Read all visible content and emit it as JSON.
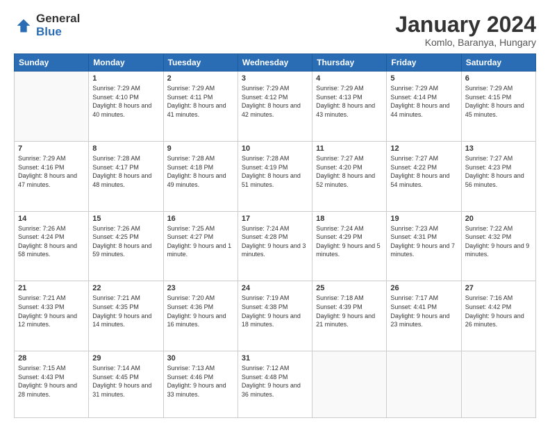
{
  "logo": {
    "general": "General",
    "blue": "Blue"
  },
  "header": {
    "month_year": "January 2024",
    "location": "Komlo, Baranya, Hungary"
  },
  "days_of_week": [
    "Sunday",
    "Monday",
    "Tuesday",
    "Wednesday",
    "Thursday",
    "Friday",
    "Saturday"
  ],
  "weeks": [
    [
      {
        "day": "",
        "sunrise": "",
        "sunset": "",
        "daylight": ""
      },
      {
        "day": "1",
        "sunrise": "Sunrise: 7:29 AM",
        "sunset": "Sunset: 4:10 PM",
        "daylight": "Daylight: 8 hours and 40 minutes."
      },
      {
        "day": "2",
        "sunrise": "Sunrise: 7:29 AM",
        "sunset": "Sunset: 4:11 PM",
        "daylight": "Daylight: 8 hours and 41 minutes."
      },
      {
        "day": "3",
        "sunrise": "Sunrise: 7:29 AM",
        "sunset": "Sunset: 4:12 PM",
        "daylight": "Daylight: 8 hours and 42 minutes."
      },
      {
        "day": "4",
        "sunrise": "Sunrise: 7:29 AM",
        "sunset": "Sunset: 4:13 PM",
        "daylight": "Daylight: 8 hours and 43 minutes."
      },
      {
        "day": "5",
        "sunrise": "Sunrise: 7:29 AM",
        "sunset": "Sunset: 4:14 PM",
        "daylight": "Daylight: 8 hours and 44 minutes."
      },
      {
        "day": "6",
        "sunrise": "Sunrise: 7:29 AM",
        "sunset": "Sunset: 4:15 PM",
        "daylight": "Daylight: 8 hours and 45 minutes."
      }
    ],
    [
      {
        "day": "7",
        "sunrise": "Sunrise: 7:29 AM",
        "sunset": "Sunset: 4:16 PM",
        "daylight": "Daylight: 8 hours and 47 minutes."
      },
      {
        "day": "8",
        "sunrise": "Sunrise: 7:28 AM",
        "sunset": "Sunset: 4:17 PM",
        "daylight": "Daylight: 8 hours and 48 minutes."
      },
      {
        "day": "9",
        "sunrise": "Sunrise: 7:28 AM",
        "sunset": "Sunset: 4:18 PM",
        "daylight": "Daylight: 8 hours and 49 minutes."
      },
      {
        "day": "10",
        "sunrise": "Sunrise: 7:28 AM",
        "sunset": "Sunset: 4:19 PM",
        "daylight": "Daylight: 8 hours and 51 minutes."
      },
      {
        "day": "11",
        "sunrise": "Sunrise: 7:27 AM",
        "sunset": "Sunset: 4:20 PM",
        "daylight": "Daylight: 8 hours and 52 minutes."
      },
      {
        "day": "12",
        "sunrise": "Sunrise: 7:27 AM",
        "sunset": "Sunset: 4:22 PM",
        "daylight": "Daylight: 8 hours and 54 minutes."
      },
      {
        "day": "13",
        "sunrise": "Sunrise: 7:27 AM",
        "sunset": "Sunset: 4:23 PM",
        "daylight": "Daylight: 8 hours and 56 minutes."
      }
    ],
    [
      {
        "day": "14",
        "sunrise": "Sunrise: 7:26 AM",
        "sunset": "Sunset: 4:24 PM",
        "daylight": "Daylight: 8 hours and 58 minutes."
      },
      {
        "day": "15",
        "sunrise": "Sunrise: 7:26 AM",
        "sunset": "Sunset: 4:25 PM",
        "daylight": "Daylight: 8 hours and 59 minutes."
      },
      {
        "day": "16",
        "sunrise": "Sunrise: 7:25 AM",
        "sunset": "Sunset: 4:27 PM",
        "daylight": "Daylight: 9 hours and 1 minute."
      },
      {
        "day": "17",
        "sunrise": "Sunrise: 7:24 AM",
        "sunset": "Sunset: 4:28 PM",
        "daylight": "Daylight: 9 hours and 3 minutes."
      },
      {
        "day": "18",
        "sunrise": "Sunrise: 7:24 AM",
        "sunset": "Sunset: 4:29 PM",
        "daylight": "Daylight: 9 hours and 5 minutes."
      },
      {
        "day": "19",
        "sunrise": "Sunrise: 7:23 AM",
        "sunset": "Sunset: 4:31 PM",
        "daylight": "Daylight: 9 hours and 7 minutes."
      },
      {
        "day": "20",
        "sunrise": "Sunrise: 7:22 AM",
        "sunset": "Sunset: 4:32 PM",
        "daylight": "Daylight: 9 hours and 9 minutes."
      }
    ],
    [
      {
        "day": "21",
        "sunrise": "Sunrise: 7:21 AM",
        "sunset": "Sunset: 4:33 PM",
        "daylight": "Daylight: 9 hours and 12 minutes."
      },
      {
        "day": "22",
        "sunrise": "Sunrise: 7:21 AM",
        "sunset": "Sunset: 4:35 PM",
        "daylight": "Daylight: 9 hours and 14 minutes."
      },
      {
        "day": "23",
        "sunrise": "Sunrise: 7:20 AM",
        "sunset": "Sunset: 4:36 PM",
        "daylight": "Daylight: 9 hours and 16 minutes."
      },
      {
        "day": "24",
        "sunrise": "Sunrise: 7:19 AM",
        "sunset": "Sunset: 4:38 PM",
        "daylight": "Daylight: 9 hours and 18 minutes."
      },
      {
        "day": "25",
        "sunrise": "Sunrise: 7:18 AM",
        "sunset": "Sunset: 4:39 PM",
        "daylight": "Daylight: 9 hours and 21 minutes."
      },
      {
        "day": "26",
        "sunrise": "Sunrise: 7:17 AM",
        "sunset": "Sunset: 4:41 PM",
        "daylight": "Daylight: 9 hours and 23 minutes."
      },
      {
        "day": "27",
        "sunrise": "Sunrise: 7:16 AM",
        "sunset": "Sunset: 4:42 PM",
        "daylight": "Daylight: 9 hours and 26 minutes."
      }
    ],
    [
      {
        "day": "28",
        "sunrise": "Sunrise: 7:15 AM",
        "sunset": "Sunset: 4:43 PM",
        "daylight": "Daylight: 9 hours and 28 minutes."
      },
      {
        "day": "29",
        "sunrise": "Sunrise: 7:14 AM",
        "sunset": "Sunset: 4:45 PM",
        "daylight": "Daylight: 9 hours and 31 minutes."
      },
      {
        "day": "30",
        "sunrise": "Sunrise: 7:13 AM",
        "sunset": "Sunset: 4:46 PM",
        "daylight": "Daylight: 9 hours and 33 minutes."
      },
      {
        "day": "31",
        "sunrise": "Sunrise: 7:12 AM",
        "sunset": "Sunset: 4:48 PM",
        "daylight": "Daylight: 9 hours and 36 minutes."
      },
      {
        "day": "",
        "sunrise": "",
        "sunset": "",
        "daylight": ""
      },
      {
        "day": "",
        "sunrise": "",
        "sunset": "",
        "daylight": ""
      },
      {
        "day": "",
        "sunrise": "",
        "sunset": "",
        "daylight": ""
      }
    ]
  ]
}
